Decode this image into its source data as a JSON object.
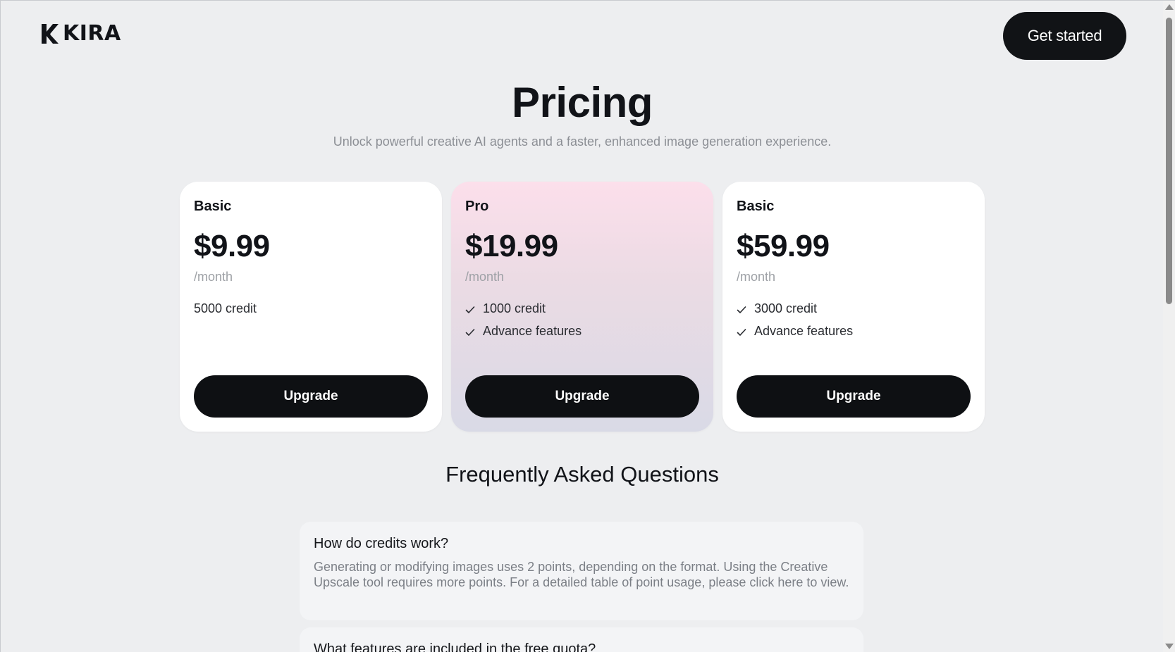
{
  "header": {
    "logo_text": "KIRA",
    "cta_label": "Get started"
  },
  "hero": {
    "title": "Pricing",
    "subtitle": "Unlock powerful creative AI agents and a faster, enhanced image generation experience."
  },
  "plans": [
    {
      "name": "Basic",
      "price": "$9.99",
      "period": "/month",
      "plain_feature": "5000 credit",
      "button_label": "Upgrade"
    },
    {
      "name": "Pro",
      "price": "$19.99",
      "period": "/month",
      "features": [
        "1000 credit",
        "Advance features"
      ],
      "button_label": "Upgrade"
    },
    {
      "name": "Basic",
      "price": "$59.99",
      "period": "/month",
      "features": [
        "3000 credit",
        "Advance features"
      ],
      "button_label": "Upgrade"
    }
  ],
  "faq": {
    "title": "Frequently Asked Questions",
    "items": [
      {
        "question": "How do credits work?",
        "answer": "Generating or modifying images uses 2 points, depending on the format. Using the Creative Upscale tool requires more points. For a detailed table of point usage, please click here to view."
      },
      {
        "question": "What features are included in the free quota?"
      }
    ]
  },
  "icons": {
    "logo": "kira-logo-icon",
    "check": "check-icon"
  }
}
